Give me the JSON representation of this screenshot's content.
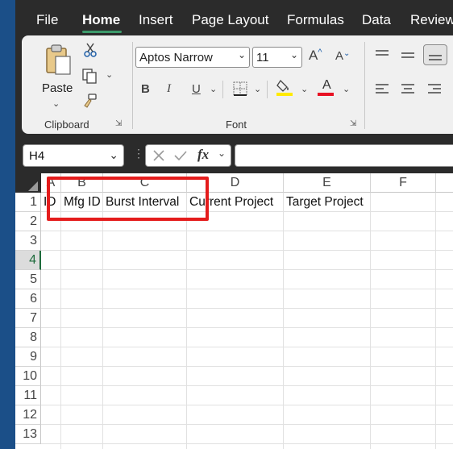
{
  "menu": {
    "tabs": [
      "File",
      "Home",
      "Insert",
      "Page Layout",
      "Formulas",
      "Data",
      "Review"
    ],
    "active_tab": "Home"
  },
  "ribbon": {
    "clipboard": {
      "paste_label": "Paste",
      "group_label": "Clipboard"
    },
    "font": {
      "font_name": "Aptos Narrow",
      "font_size": "11",
      "grow_label": "A",
      "shrink_label": "A",
      "bold": "B",
      "italic": "I",
      "underline": "U",
      "font_color_label": "A",
      "group_label": "Font",
      "fill_color": "#ffea00",
      "font_color": "#e81123"
    }
  },
  "formula_bar": {
    "name_box": "H4",
    "fx_label": "fx",
    "formula": ""
  },
  "grid": {
    "columns": [
      "A",
      "B",
      "C",
      "D",
      "E",
      "F"
    ],
    "rows": [
      "1",
      "2",
      "3",
      "4",
      "5",
      "6",
      "7",
      "8",
      "9",
      "10",
      "11",
      "12",
      "13"
    ],
    "selected_row": "4",
    "row1": [
      "ID",
      "Mfg ID",
      "Burst Interval",
      "Current Project",
      "Target Project",
      ""
    ]
  },
  "colors": {
    "highlight": "#e41c1c",
    "accent": "#3d9a6b",
    "window_dark": "#2b2b2b",
    "left_bar": "#1b4f88"
  }
}
